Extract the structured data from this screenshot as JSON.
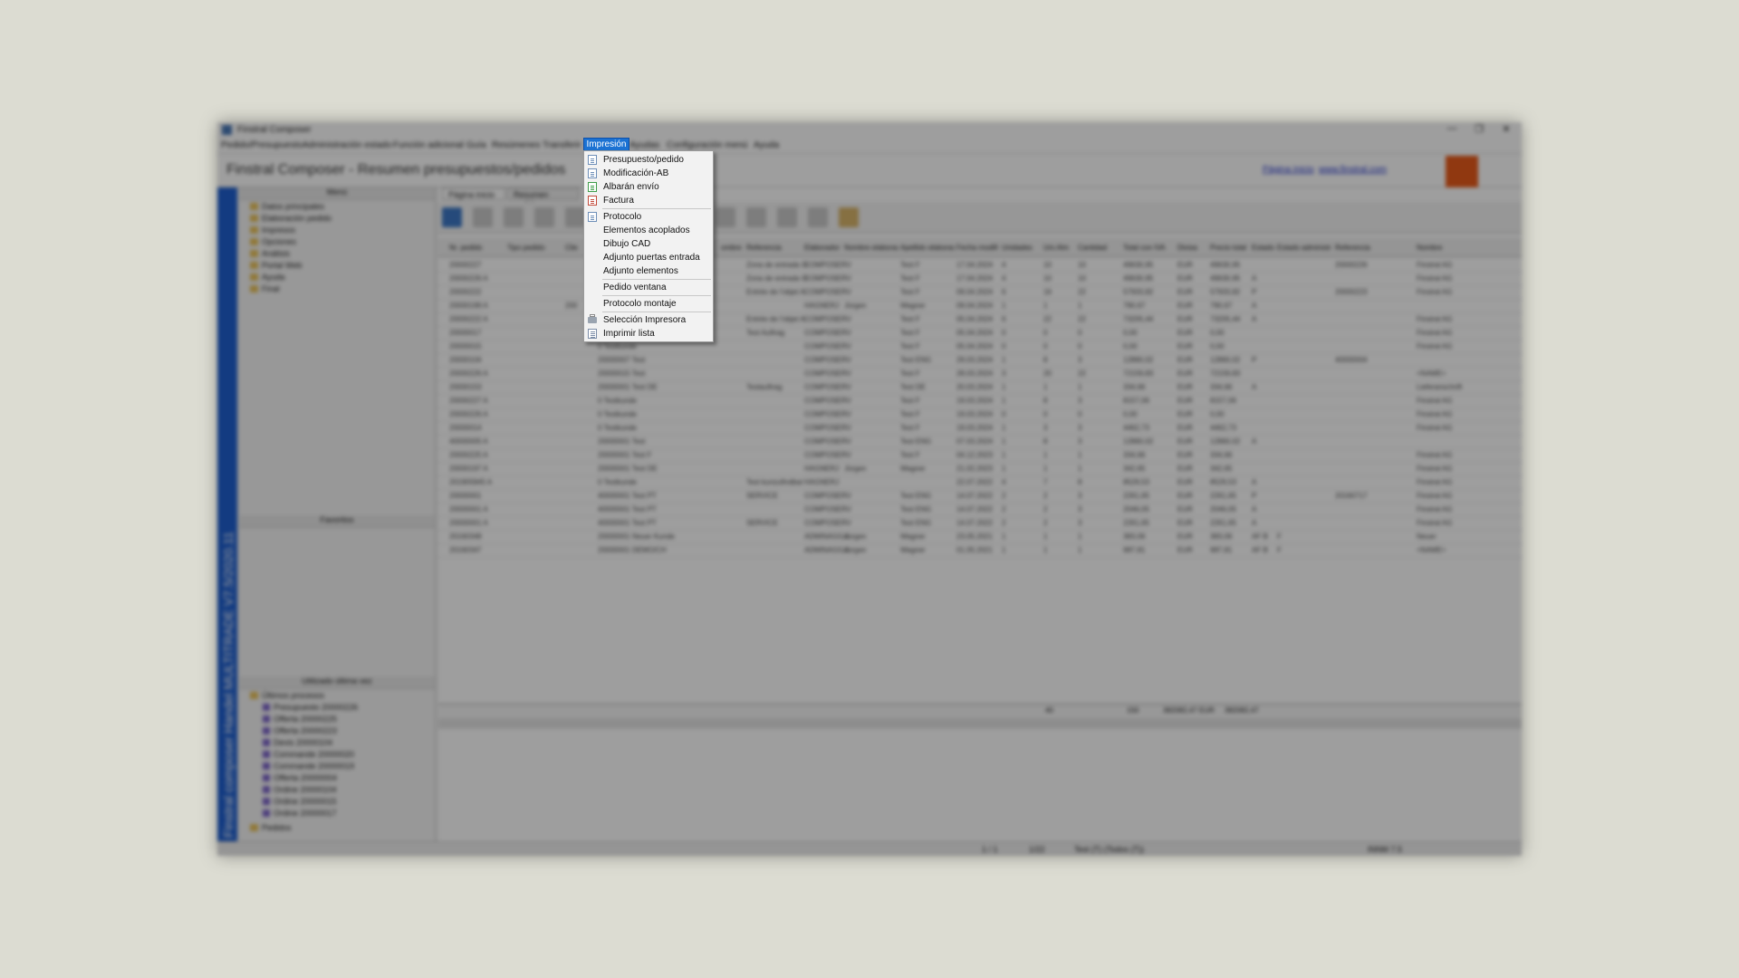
{
  "window": {
    "title": "Finstral Composer",
    "minimize": "—",
    "restore": "❐",
    "close": "✕"
  },
  "menubar": [
    "Pedido/Presupuesto",
    "Administración estado",
    "Función adicional",
    "Guía",
    "Resúmenes",
    "Transferir",
    "Impresión",
    "Ayudas",
    "Configuración menú",
    "Ayuda"
  ],
  "open_menu": {
    "title": "Impresión",
    "items": [
      {
        "label": "Presupuesto/pedido",
        "icon": "document-icon"
      },
      {
        "label": "Modificación-AB",
        "icon": "document-icon"
      },
      {
        "label": "Albarán envío",
        "icon": "delivery-note-icon"
      },
      {
        "label": "Factura",
        "icon": "invoice-icon"
      },
      {
        "label": "Protocolo",
        "icon": "protocol-icon"
      },
      {
        "label": "Elementos acoplados",
        "icon": ""
      },
      {
        "label": "Dibujo CAD",
        "icon": ""
      },
      {
        "label": "Adjunto puertas entrada",
        "icon": ""
      },
      {
        "label": "Adjunto elementos",
        "icon": ""
      },
      {
        "label": "Pedido ventana",
        "icon": ""
      },
      {
        "label": "Protocolo montaje",
        "icon": ""
      },
      {
        "label": "Selección Impresora",
        "icon": "printer-icon"
      },
      {
        "label": "Imprimir lista",
        "icon": "print-list-icon"
      }
    ]
  },
  "header": {
    "page_title": "Finstral Composer - Resumen presupuestos/pedidos",
    "link_home": "Página inicio",
    "link_web": "www.finstral.com"
  },
  "sidebar": {
    "vertical_label": "Finstral composer Handel MULTITRADE V7.5/2020.11",
    "menu_header": "Menú",
    "menu_items": [
      "Datos principales",
      "Elaboración pedido",
      "Impresos",
      "Opciones",
      "Análisis",
      "Portal Web",
      "Ayuda",
      "Final"
    ],
    "favorites_header": "Favoritos",
    "recent_header": "Utilizado última vez",
    "recent_root": "Últimos procesos",
    "recent_items": [
      "Presupuesto 20000226",
      "Offerta 20000225",
      "Offerta 20000223",
      "Devis 20000104",
      "Commande 20000020",
      "Commande 20000019",
      "Offerta 20000004",
      "Ordine 20000104",
      "Ordine 20000015",
      "Ordine 20000017"
    ],
    "orders_root": "Pedidos"
  },
  "tabs": [
    "Página inicio",
    "Resumen pedido"
  ],
  "grid": {
    "columns": [
      "Nr. pedido",
      "Tipo pedido",
      "Clie",
      "",
      "ombre",
      "Referencia",
      "Elaborador",
      "Nombre elaborador",
      "Apellido elaborador",
      "Fecha modifi",
      "Unidades",
      "Uni.Alm",
      "Cantidad",
      "Total con IVA",
      "Divisa",
      "Precio total",
      "Estado",
      "Estado administr.",
      "Referencia",
      "Nombre"
    ],
    "rows": [
      [
        "20000227",
        "",
        "",
        "",
        "",
        "Zona de entrada O",
        "COMPOSERV",
        "",
        "Test F",
        "17.04.2024",
        "4",
        "10",
        "10",
        "49630,95",
        "EUR",
        "49630,95",
        "",
        "",
        "20000226",
        "Finstral AG"
      ],
      [
        "20000226 A",
        "",
        "",
        "",
        "",
        "Zona de entrada O",
        "COMPOSERV",
        "",
        "Test F",
        "17.04.2024",
        "4",
        "10",
        "10",
        "49630,95",
        "EUR",
        "49630,95",
        "A",
        "",
        "",
        "Finstral AG"
      ],
      [
        "20000222",
        "",
        "",
        "",
        "",
        "Entrée de l'objet A",
        "COMPOSERV",
        "",
        "Test F",
        "09.04.2024",
        "6",
        "16",
        "22",
        "57933,82",
        "EUR",
        "57933,82",
        "P",
        "",
        "20000223",
        "Finstral AG"
      ],
      [
        "20000199 A",
        "",
        "200",
        "",
        "",
        "",
        "HAGNERJ",
        "Jürgen",
        "Wagner",
        "09.04.2024",
        "1",
        "1",
        "1",
        "790,67",
        "EUR",
        "790,67",
        "A",
        "",
        "",
        ""
      ],
      [
        "20000222 A",
        "",
        "",
        "",
        "",
        "Entrée de l'objet A",
        "COMPOSERV",
        "",
        "Test F",
        "05.04.2024",
        "6",
        "22",
        "22",
        "73205,44",
        "EUR",
        "73205,44",
        "A",
        "",
        "",
        "Finstral AG"
      ],
      [
        "20000017",
        "",
        "",
        "",
        "",
        "Test Auftrag",
        "COMPOSERV",
        "",
        "Test F",
        "05.04.2024",
        "0",
        "0",
        "0",
        "0,00",
        "EUR",
        "0,00",
        "",
        "",
        "",
        "Finstral AG"
      ],
      [
        "20000015",
        "",
        "",
        "0 Testkunde",
        "",
        "",
        "COMPOSERV",
        "",
        "Test F",
        "05.04.2024",
        "0",
        "0",
        "0",
        "0,00",
        "EUR",
        "0,00",
        "",
        "",
        "",
        "Finstral AG"
      ],
      [
        "20000104",
        "",
        "",
        "20000007 Test",
        "",
        "",
        "COMPOSERV",
        "",
        "Test ENG",
        "29.03.2024",
        "1",
        "8",
        "3",
        "12860,02",
        "EUR",
        "12860,02",
        "P",
        "",
        "40000004",
        ""
      ],
      [
        "20000226 A",
        "",
        "",
        "20000015 Test",
        "",
        "",
        "COMPOSERV",
        "",
        "Test F",
        "28.03.2024",
        "3",
        "20",
        "22",
        "72159,83",
        "EUR",
        "72159,83",
        "",
        "",
        "",
        "<NAME>"
      ],
      [
        "20000153",
        "",
        "",
        "20000001 Test DE",
        "",
        "Testauftrag",
        "COMPOSERV",
        "",
        "Test DE",
        "20.03.2024",
        "1",
        "1",
        "1",
        "334,66",
        "EUR",
        "334,66",
        "A",
        "",
        "",
        "Lieferanschrift"
      ],
      [
        "20000227 A",
        "",
        "",
        "0 Testkunde",
        "",
        "",
        "COMPOSERV",
        "",
        "Test F",
        "19.03.2024",
        "1",
        "8",
        "3",
        "8157,06",
        "EUR",
        "8157,06",
        "",
        "",
        "",
        "Finstral AG"
      ],
      [
        "20000226 A",
        "",
        "",
        "0 Testkunde",
        "",
        "",
        "COMPOSERV",
        "",
        "Test F",
        "19.03.2024",
        "0",
        "0",
        "0",
        "0,00",
        "EUR",
        "0,00",
        "",
        "",
        "",
        "Finstral AG"
      ],
      [
        "20000014",
        "",
        "",
        "0 Testkunde",
        "",
        "",
        "COMPOSERV",
        "",
        "Test F",
        "19.03.2024",
        "1",
        "3",
        "3",
        "4462,73",
        "EUR",
        "4462,73",
        "",
        "",
        "",
        "Finstral AG"
      ],
      [
        "40000005 A",
        "",
        "",
        "20000001 Test",
        "",
        "",
        "COMPOSERV",
        "",
        "Test ENG",
        "07.03.2024",
        "1",
        "8",
        "3",
        "12860,02",
        "EUR",
        "12860,02",
        "A",
        "",
        "",
        ""
      ],
      [
        "20000225 A",
        "",
        "",
        "20000001 Test F",
        "",
        "",
        "COMPOSERV",
        "",
        "Test F",
        "04.12.2023",
        "1",
        "1",
        "1",
        "334,66",
        "EUR",
        "334,66",
        "",
        "",
        "",
        "Finstral AG"
      ],
      [
        "20000197 A",
        "",
        "",
        "20000001 Test DE",
        "",
        "",
        "HAGNERJ",
        "Jürgen",
        "Wagner",
        "21.02.2023",
        "1",
        "1",
        "1",
        "342,65",
        "EUR",
        "342,65",
        "",
        "",
        "",
        "Finstral AG"
      ],
      [
        "201905845 A",
        "",
        "",
        "0 Testkunde",
        "",
        "Test kunzufindbar",
        "HAGNERJ",
        "",
        "",
        "22.07.2022",
        "4",
        "7",
        "8",
        "8529,53",
        "EUR",
        "8529,53",
        "A",
        "",
        "",
        "Finstral AG"
      ],
      [
        "20000001",
        "",
        "",
        "40000001 Test PT",
        "",
        "SERVICE",
        "COMPOSERV",
        "",
        "Test ENG",
        "14.07.2022",
        "2",
        "2",
        "3",
        "2261,65",
        "EUR",
        "2261,65",
        "P",
        "",
        "20160717",
        "Finstral AG"
      ],
      [
        "20000001 A",
        "",
        "",
        "40000001 Test PT",
        "",
        "",
        "COMPOSERV",
        "",
        "Test ENG",
        "14.07.2022",
        "2",
        "2",
        "3",
        "2046,05",
        "EUR",
        "2046,05",
        "A",
        "",
        "",
        "Finstral AG"
      ],
      [
        "20000001 A",
        "",
        "",
        "40000001 Test PT",
        "",
        "SERVICE",
        "COMPOSERV",
        "",
        "Test ENG",
        "14.07.2022",
        "2",
        "2",
        "3",
        "2261,65",
        "EUR",
        "2261,65",
        "A",
        "",
        "",
        "Finstral AG"
      ],
      [
        "20160348",
        "",
        "",
        "20000001 Neuer Kunde",
        "",
        "",
        "ADMINAGGA",
        "Jürgen",
        "Wagner",
        "23.05.2021",
        "1",
        "1",
        "1",
        "383,06",
        "EUR",
        "383,06",
        "AF B",
        "F",
        "",
        "Neuer"
      ],
      [
        "20160347",
        "",
        "",
        "20000001 DEMO/CH",
        "",
        "",
        "ADMINAGGA",
        "Jürgen",
        "Wagner",
        "01.05.2021",
        "1",
        "1",
        "1",
        "987,81",
        "EUR",
        "987,81",
        "AF B",
        "F",
        "",
        "<NAME>"
      ]
    ],
    "totals": {
      "units": "40",
      "quantity": "150",
      "total": "382082,47",
      "currency": "EUR",
      "price_total": "382082,47"
    }
  },
  "statusbar": {
    "position": "1 / 1",
    "count": "1/22",
    "filter": "Test (T) (Todos (T))",
    "user": "INNM   7.5"
  },
  "colors": {
    "menu_highlight": "#1b72d3",
    "sidebar_band": "#1e5fd0",
    "logo": "#e85a19",
    "page_background": "#dcdcd2"
  }
}
